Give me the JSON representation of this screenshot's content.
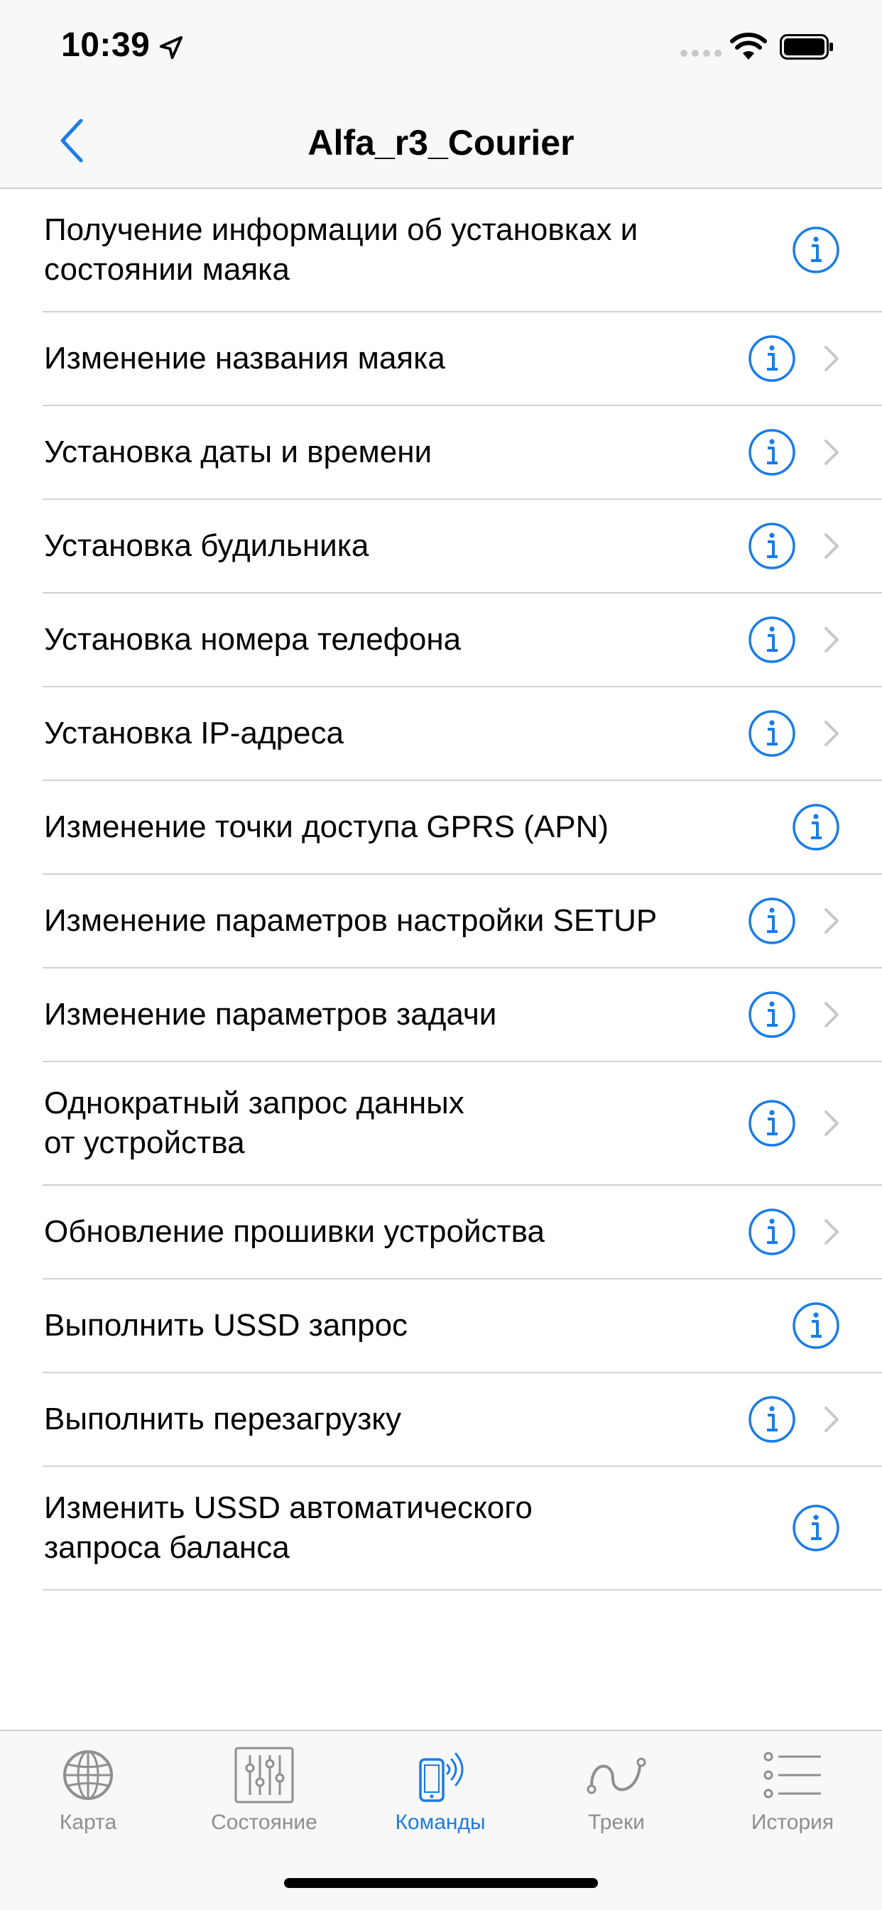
{
  "status_bar": {
    "time": "10:39"
  },
  "nav": {
    "title": "Alfa_r3_Courier"
  },
  "colors": {
    "accent": "#1a7ce6",
    "chevron": "#c7c7cc",
    "separator": "#d1d1d6",
    "tab_inactive": "#8e8e93"
  },
  "commands": [
    {
      "label": "Получение информации об установках и\nсостоянии маяка",
      "chevron": false
    },
    {
      "label": "Изменение названия маяка",
      "chevron": true
    },
    {
      "label": "Установка даты и времени",
      "chevron": true
    },
    {
      "label": "Установка будильника",
      "chevron": true
    },
    {
      "label": "Установка номера телефона",
      "chevron": true
    },
    {
      "label": "Установка IP-адреса",
      "chevron": true
    },
    {
      "label": "Изменение точки доступа GPRS (APN)",
      "chevron": false
    },
    {
      "label": "Изменение параметров настройки SETUP",
      "chevron": true
    },
    {
      "label": "Изменение параметров задачи",
      "chevron": true
    },
    {
      "label": "Однократный запрос данных\nот устройства",
      "chevron": true
    },
    {
      "label": "Обновление прошивки устройства",
      "chevron": true
    },
    {
      "label": "Выполнить USSD запрос",
      "chevron": false
    },
    {
      "label": "Выполнить перезагрузку",
      "chevron": true
    },
    {
      "label": "Изменить USSD автоматического\nзапроса баланса",
      "chevron": false
    }
  ],
  "tabs": [
    {
      "label": "Карта",
      "icon": "globe-icon",
      "active": false
    },
    {
      "label": "Состояние",
      "icon": "sliders-icon",
      "active": false
    },
    {
      "label": "Команды",
      "icon": "phone-signal-icon",
      "active": true
    },
    {
      "label": "Треки",
      "icon": "route-icon",
      "active": false
    },
    {
      "label": "История",
      "icon": "list-icon",
      "active": false
    }
  ]
}
